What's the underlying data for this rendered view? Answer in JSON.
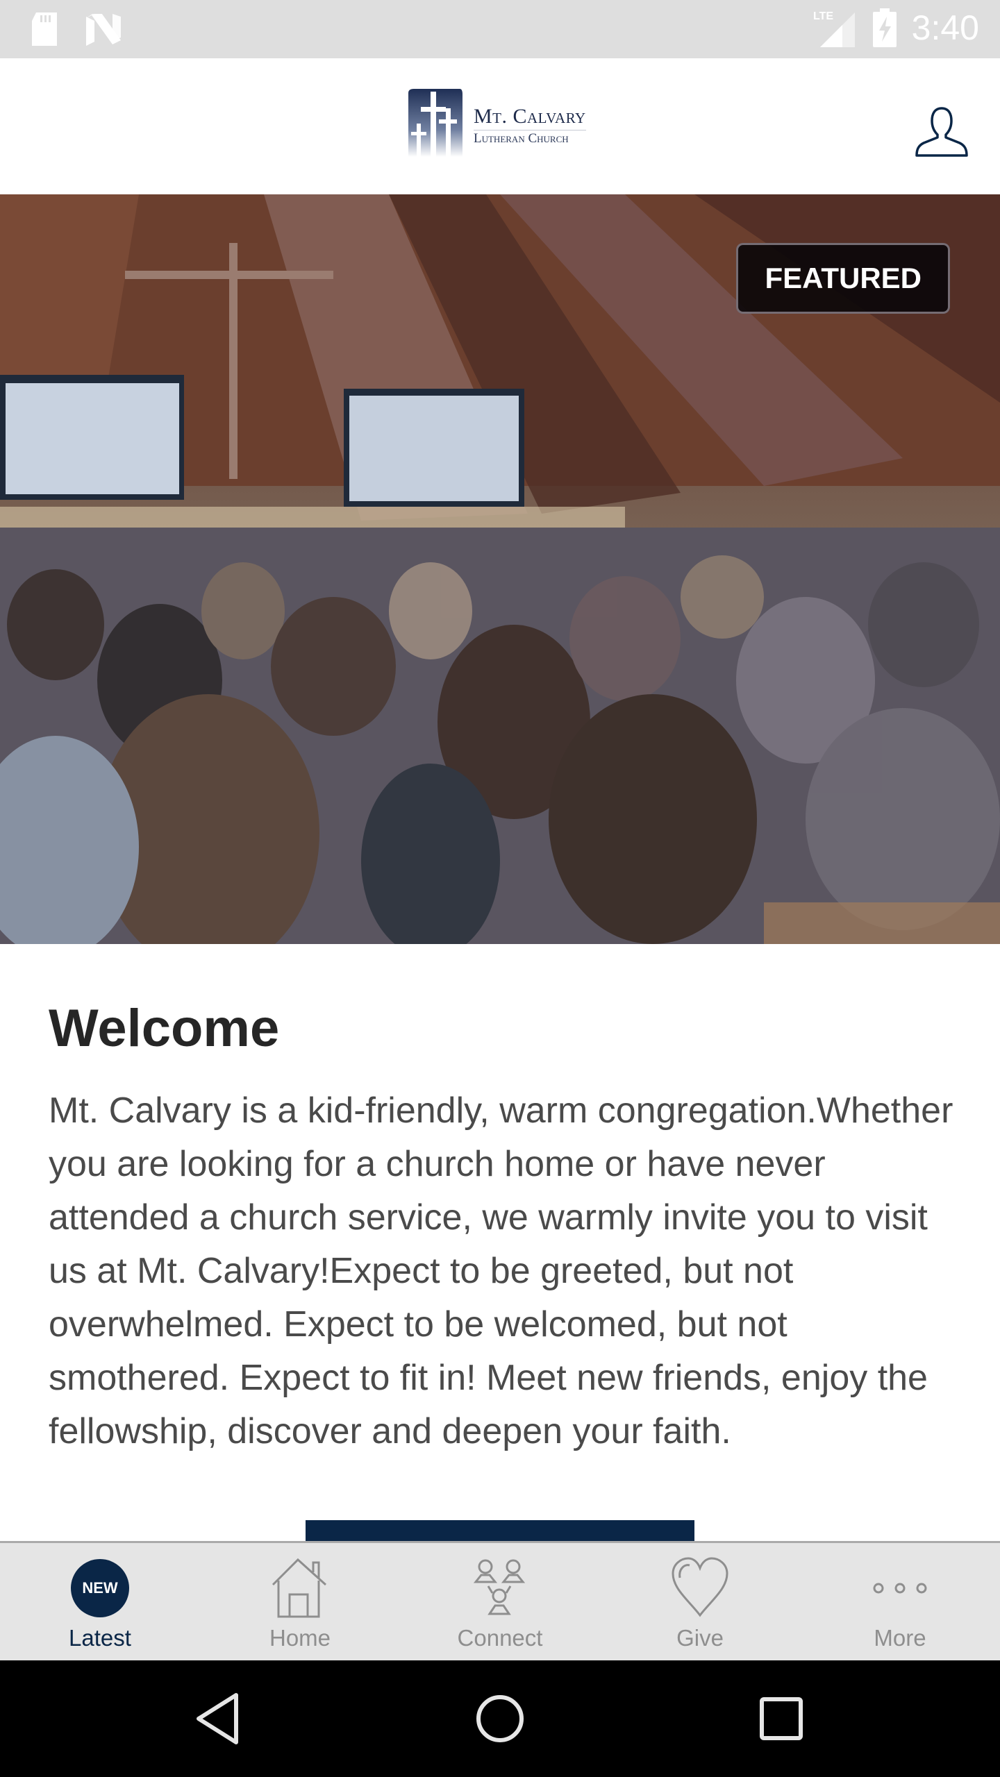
{
  "status_bar": {
    "time": "3:40",
    "network": "LTE",
    "icons": [
      "sd-card-icon",
      "n-notification-icon",
      "lte-signal-icon",
      "battery-charging-icon"
    ]
  },
  "header": {
    "logo": {
      "line1": "Mt. Calvary",
      "line2": "Lutheran Church"
    },
    "profile_icon": "person-outline-icon"
  },
  "hero": {
    "badge": "FEATURED",
    "image_alt": "Congregation seated in church sanctuary"
  },
  "article": {
    "title": "Welcome",
    "body": "Mt. Calvary is a kid-friendly, warm congregation.Whether you are looking for a church home or have never attended a church service, we warmly invite you to visit us at Mt. Calvary!Expect to be greeted, but not overwhelmed. Expect to be welcomed, but not smothered. Expect to fit in! Meet new friends, enjoy the fellowship, discover and deepen your faith."
  },
  "tabs": [
    {
      "label": "Latest",
      "icon": "new-badge-icon",
      "badge": "NEW",
      "active": true
    },
    {
      "label": "Home",
      "icon": "house-icon",
      "active": false
    },
    {
      "label": "Connect",
      "icon": "people-group-icon",
      "active": false
    },
    {
      "label": "Give",
      "icon": "heart-icon",
      "active": false
    },
    {
      "label": "More",
      "icon": "more-dots-icon",
      "active": false
    }
  ],
  "colors": {
    "brand": "#0a2647",
    "tab_inactive": "#8e8e8e",
    "tab_bar_bg": "#e5e5e5",
    "status_bar_bg": "#dedede"
  }
}
